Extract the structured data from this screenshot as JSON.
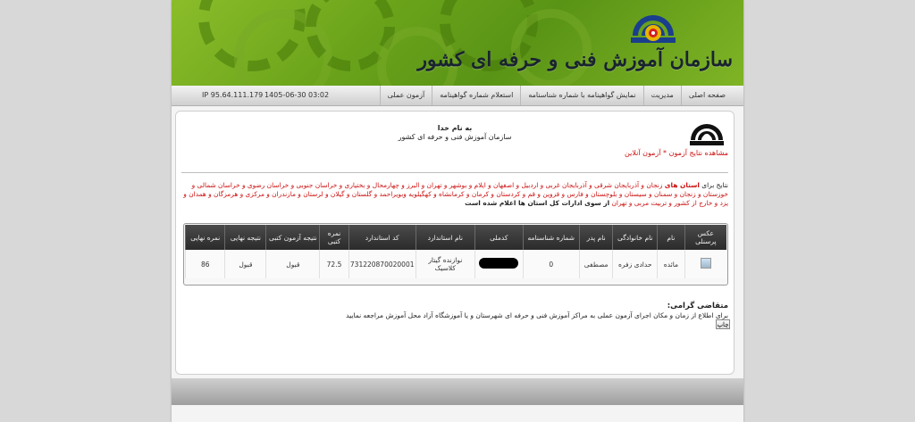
{
  "header": {
    "org_title": "سازمان آموزش فنی و حرفه ای کشور"
  },
  "nav": {
    "items": [
      {
        "label": "صفحه اصلی"
      },
      {
        "label": "مدیریت"
      },
      {
        "label": "نمایش گواهینامه با شماره شناسنامه"
      },
      {
        "label": "استعلام شماره گواهینامه"
      },
      {
        "label": "آزمون عملی"
      }
    ],
    "datetime": "1405-06-30 03:02",
    "ip": "IP 95.64.111.179"
  },
  "content": {
    "bism": "به نام خدا",
    "subtitle": "سازمان آموزش فنی و حرفه ای کشور",
    "online_link": "مشاهده نتایج آزمون * آزمون آنلاین",
    "notice": {
      "prefix": "نتایج برای",
      "provinces_label": "استان های",
      "provinces": "زنجان و آذربایجان شرقی و آذربایجان غربی و اردبیل و اصفهان و ایلام و بوشهر و تهران و البرز و چهارمحال و بختیاری و خراسان جنوبی و خراسان رضوی و خراسان شمالی و خوزستان و زنجان و سمنان و سیستان و بلوچستان و فارس و قزوین و قم و کردستان و کرمان و کرمانشاه و کهگیلویه وبویراحمد و گلستان و گیلان و لرستان و مازندران و مرکزی و هرمزگان و همدان و یزد و خارج از کشور و تربیت مربی و تهران",
      "suffix": "از سوی ادارات کل استان ها اعلام شده است"
    },
    "table": {
      "headers": [
        "عکس پرسنلی",
        "نام",
        "نام خانوادگی",
        "نام پدر",
        "شماره شناسنامه",
        "کدملی",
        "نام استاندارد",
        "کد استاندارد",
        "نمره کتبی",
        "نتیجه آزمون کتبی",
        "نتیجه نهایی",
        "نمره نهایی"
      ],
      "row": {
        "first_name": "مائده",
        "last_name": "حدادی زفره",
        "father_name": "مصطفی",
        "id_number": "0",
        "standard_name": "نوازنده گیتار کلاسیک",
        "standard_code": "731220870020001",
        "written_score": "72.5",
        "written_result": "قبول",
        "final_result": "قبول",
        "final_score": "86"
      }
    },
    "applicants_title": "متقاضی گرامی:",
    "applicants_text": "برای اطلاع از زمان و مکان اجرای آزمون عملی به مراکز آموزش فنی و حرفه ای شهرستان و یا آموزشگاه آزاد محل آموزش مراجعه نمایید",
    "print_label": "چاپ"
  }
}
